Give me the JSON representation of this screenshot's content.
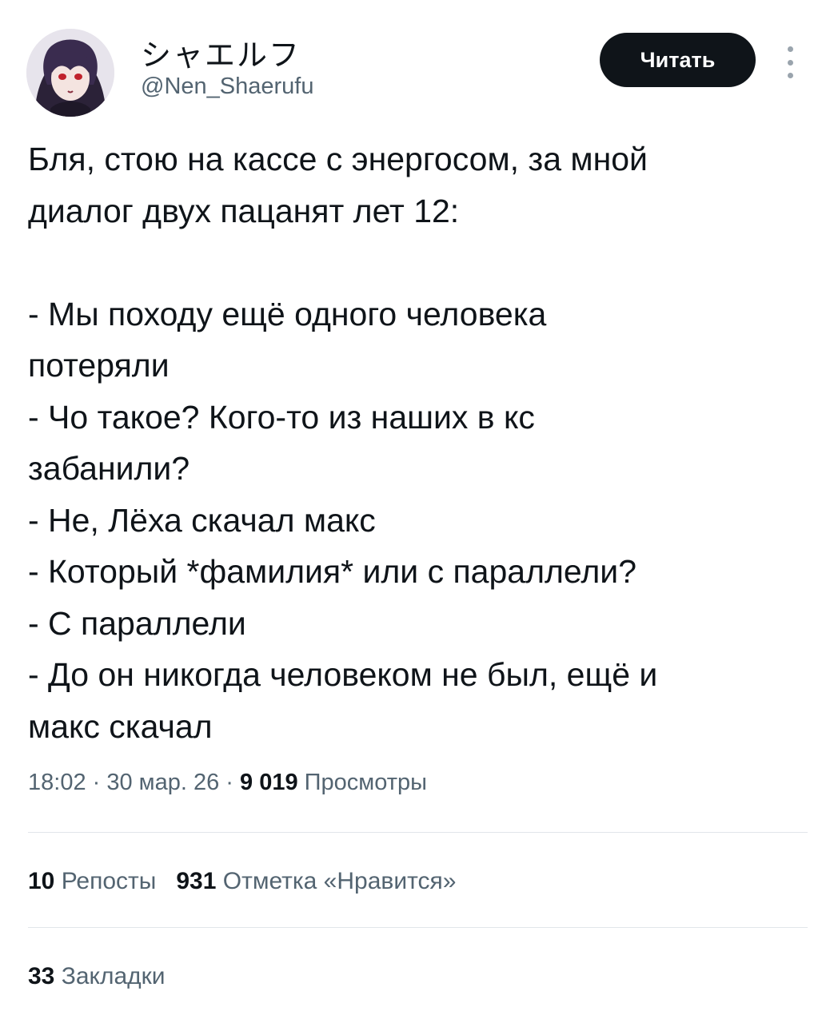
{
  "author": {
    "display_name": "シャエルフ",
    "handle": "@Nen_Shaerufu",
    "avatar_icon": "anime-avatar"
  },
  "follow_button": {
    "label": "Читать"
  },
  "more_icon": "more-vertical-icon",
  "tweet": {
    "lines": [
      "Бля, стою на кассе с энергосом, за мной",
      "диалог двух пацанят лет 12:",
      "",
      "- Мы походу ещё одного человека",
      "потеряли",
      "- Чо такое? Кого-то из наших в кс",
      "забанили?",
      "- Не, Лёха скачал макс",
      "- Который *фамилия* или с параллели?",
      "- С параллели",
      "- До он никогда человеком не был, ещё и",
      "макс скачал"
    ]
  },
  "meta": {
    "time": "18:02",
    "date": "30 мар. 26",
    "separator": " · ",
    "views_count": "9 019",
    "views_label": "Просмотры"
  },
  "stats": {
    "reposts_count": "10",
    "reposts_label": "Репосты",
    "likes_count": "931",
    "likes_label": "Отметка «Нравится»",
    "bookmarks_count": "33",
    "bookmarks_label": "Закладки"
  },
  "colors": {
    "text": "#0f1419",
    "secondary": "#536471",
    "button_bg": "#0f1419",
    "divider": "#e1e6ea"
  }
}
